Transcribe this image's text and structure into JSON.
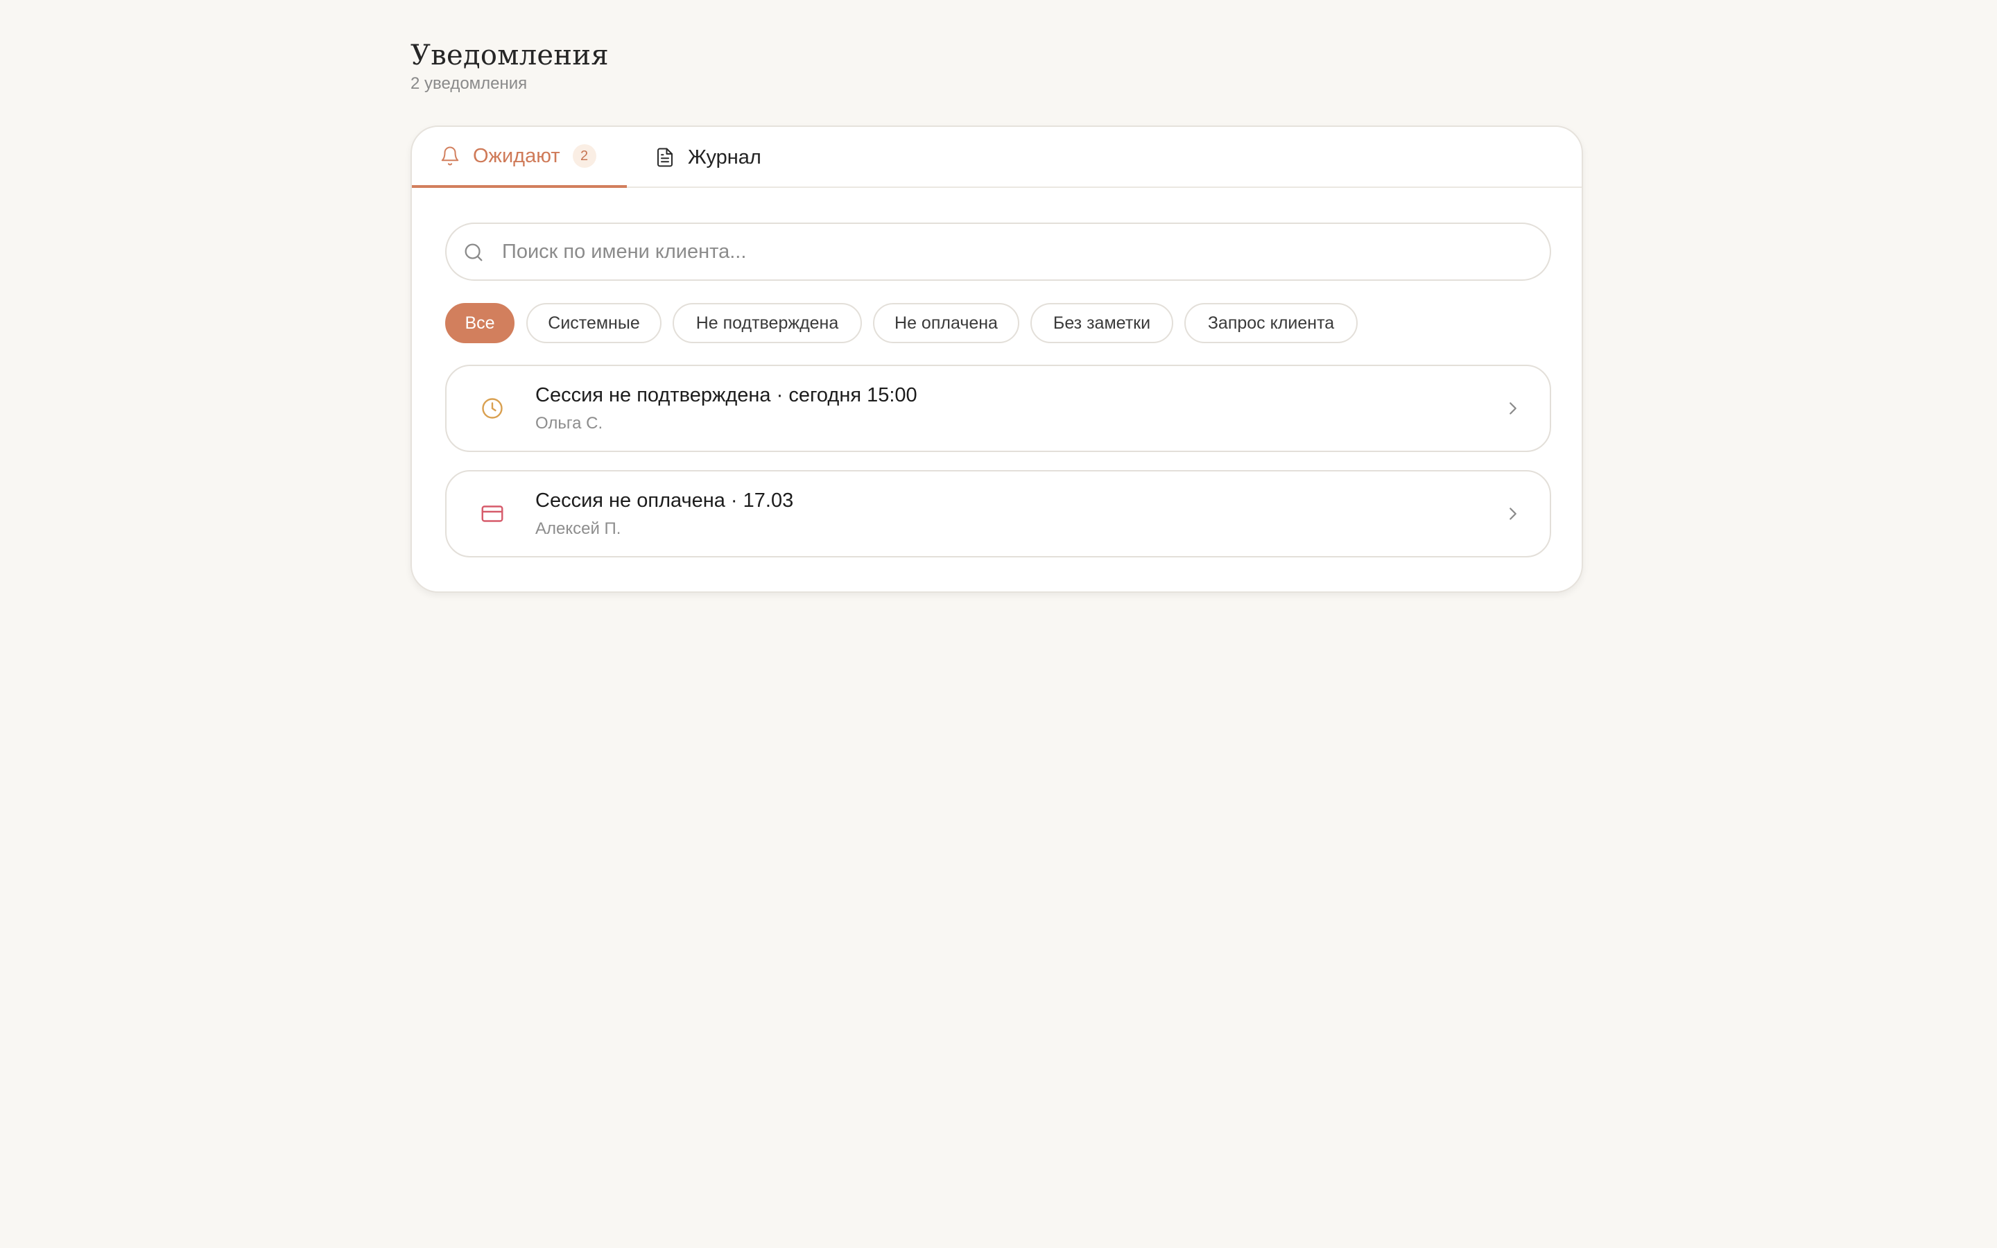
{
  "header": {
    "title": "Уведомления",
    "subtitle": "2 уведомления"
  },
  "tabs": [
    {
      "label": "Ожидают",
      "badge": "2",
      "icon": "bell-icon",
      "active": true
    },
    {
      "label": "Журнал",
      "icon": "document-icon",
      "active": false
    }
  ],
  "search": {
    "placeholder": "Поиск по имени клиента...",
    "value": ""
  },
  "filters": [
    {
      "label": "Все",
      "active": true
    },
    {
      "label": "Системные",
      "active": false
    },
    {
      "label": "Не подтверждена",
      "active": false
    },
    {
      "label": "Не оплачена",
      "active": false
    },
    {
      "label": "Без заметки",
      "active": false
    },
    {
      "label": "Запрос клиента",
      "active": false
    }
  ],
  "notifications": [
    {
      "title": "Сессия не подтверждена · сегодня 15:00",
      "client": "Ольга С.",
      "icon": "clock-icon",
      "color": "#d9a050"
    },
    {
      "title": "Сессия не оплачена · 17.03",
      "client": "Алексей П.",
      "icon": "credit-card-icon",
      "color": "#d65a6a"
    }
  ],
  "colors": {
    "accent": "#d27f5d",
    "background": "#f9f7f3"
  }
}
